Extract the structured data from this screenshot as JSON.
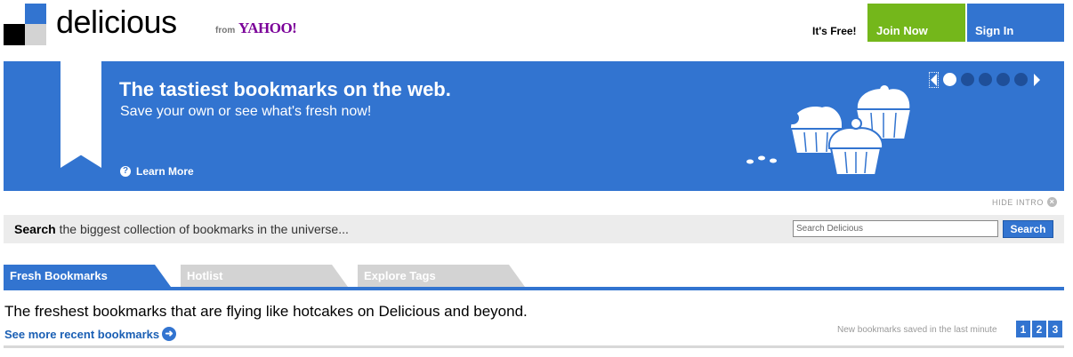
{
  "header": {
    "logo_text": "delicious",
    "from_text": "from",
    "yahoo_text": "YAHOO!",
    "its_free": "It's Free!",
    "join_label": "Join Now",
    "signin_label": "Sign In"
  },
  "banner": {
    "title": "The tastiest bookmarks on the web.",
    "subtitle": "Save your own or see what's fresh now!",
    "learn_more": "Learn More",
    "carousel": {
      "slides": 6,
      "active_slide": 1
    },
    "icons": [
      "bookmark-ribbon-icon",
      "cupcakes-illustration"
    ]
  },
  "intro": {
    "hide_label": "HIDE INTRO"
  },
  "search": {
    "label_bold": "Search",
    "label_rest": " the biggest collection of bookmarks in the universe...",
    "placeholder": "Search Delicious",
    "button": "Search"
  },
  "tabs": [
    {
      "label": "Fresh Bookmarks",
      "active": true
    },
    {
      "label": "Hotlist",
      "active": false
    },
    {
      "label": "Explore Tags",
      "active": false
    }
  ],
  "content": {
    "description": "The freshest bookmarks that are flying like hotcakes on Delicious and beyond.",
    "see_more": "See more recent bookmarks",
    "new_saved": "New bookmarks saved in the last minute",
    "pages": [
      "1",
      "2",
      "3"
    ]
  },
  "colors": {
    "brand_blue": "#3274d0",
    "join_green": "#74b71b",
    "yahoo_purple": "#7b0099"
  }
}
